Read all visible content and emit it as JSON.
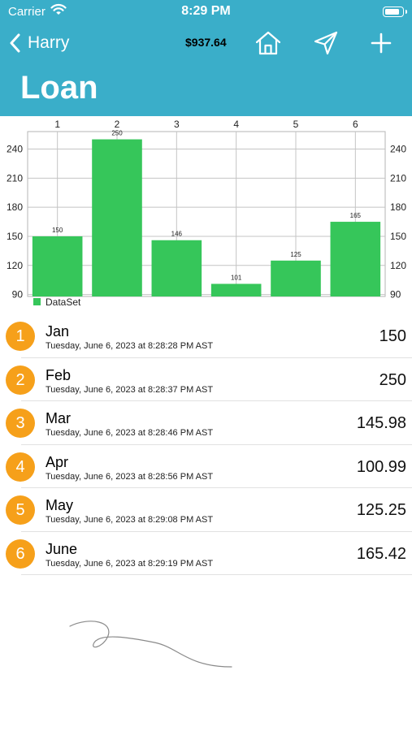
{
  "status_bar": {
    "carrier": "Carrier",
    "time": "8:29 PM",
    "battery_level": 0.85
  },
  "nav": {
    "back_label": "Harry",
    "balance": "$937.64",
    "title": "Loan"
  },
  "icons": {
    "back": "chevron-left-icon",
    "home": "house-icon",
    "send": "paper-plane-icon",
    "add": "plus-icon",
    "wifi": "wifi-icon",
    "battery": "battery-icon"
  },
  "colors": {
    "header": "#3aaec9",
    "bar": "#36c65a",
    "badge": "#f6a01a",
    "text_on_header": "#ffffff"
  },
  "chart_data": {
    "type": "bar",
    "categories": [
      "1",
      "2",
      "3",
      "4",
      "5",
      "6"
    ],
    "values": [
      150,
      250,
      146,
      101,
      125,
      165
    ],
    "y_ticks": [
      "240",
      "210",
      "180",
      "150",
      "120",
      "90"
    ],
    "ylim": [
      88,
      258
    ],
    "grid": true,
    "legend": "bottom-left",
    "series": [
      {
        "name": "DataSet",
        "values": [
          150,
          250,
          146,
          101,
          125,
          165
        ]
      }
    ]
  },
  "entries": [
    {
      "index": "1",
      "month": "Jan",
      "date": "Tuesday, June 6, 2023 at 8:28:28 PM AST",
      "amount": "150"
    },
    {
      "index": "2",
      "month": "Feb",
      "date": "Tuesday, June 6, 2023 at 8:28:37 PM AST",
      "amount": "250"
    },
    {
      "index": "3",
      "month": "Mar",
      "date": "Tuesday, June 6, 2023 at 8:28:46 PM AST",
      "amount": "145.98"
    },
    {
      "index": "4",
      "month": "Apr",
      "date": "Tuesday, June 6, 2023 at 8:28:56 PM AST",
      "amount": "100.99"
    },
    {
      "index": "5",
      "month": "May",
      "date": "Tuesday, June 6, 2023 at 8:29:08 PM AST",
      "amount": "125.25"
    },
    {
      "index": "6",
      "month": "June",
      "date": "Tuesday, June 6, 2023 at 8:29:19 PM AST",
      "amount": "165.42"
    }
  ]
}
